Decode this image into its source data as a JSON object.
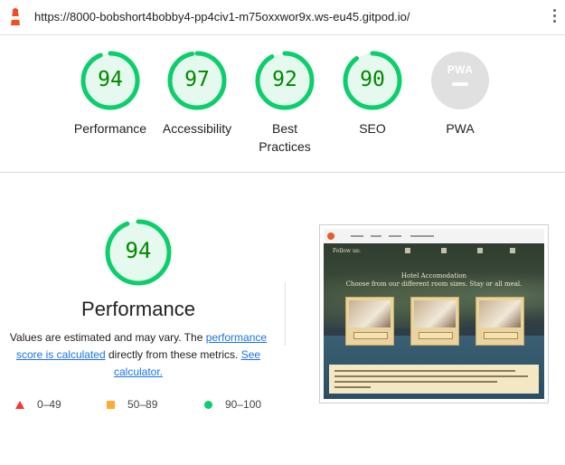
{
  "url": "https://8000-bobshort4bobby4-pp4civ1-m75oxxwor9x.ws-eu45.gitpod.io/",
  "colors": {
    "pass": "#0cce6b",
    "pass_text": "#008800",
    "average": "#ffaa33",
    "fail": "#ff3333",
    "na": "#e0e0e0",
    "link": "#1a73e8"
  },
  "scores": [
    {
      "label": "Performance",
      "score": "94",
      "fraction": 0.94
    },
    {
      "label": "Accessibility",
      "score": "97",
      "fraction": 0.97
    },
    {
      "label": "Best Practices",
      "score": "92",
      "fraction": 0.92
    },
    {
      "label": "SEO",
      "score": "90",
      "fraction": 0.9
    }
  ],
  "pwa": {
    "label": "PWA",
    "badge": "PWA",
    "icon": "pwa-badge-icon"
  },
  "detail": {
    "score": "94",
    "fraction": 0.94,
    "title": "Performance",
    "desc_before": "Values are estimated and may vary. The ",
    "desc_link1": "performance score is calculated",
    "desc_middle": " directly from these metrics. ",
    "desc_link2": "See calculator."
  },
  "legend": [
    {
      "range": "0–49",
      "icon": "fail-triangle-icon"
    },
    {
      "range": "50–89",
      "icon": "average-square-icon"
    },
    {
      "range": "90–100",
      "icon": "pass-circle-icon"
    }
  ],
  "thumbnail": {
    "follow": "Follow us:",
    "heading_1": "Hotel Accomodation",
    "heading_2": "Choose from our different room sizes. Stay or all meal."
  }
}
